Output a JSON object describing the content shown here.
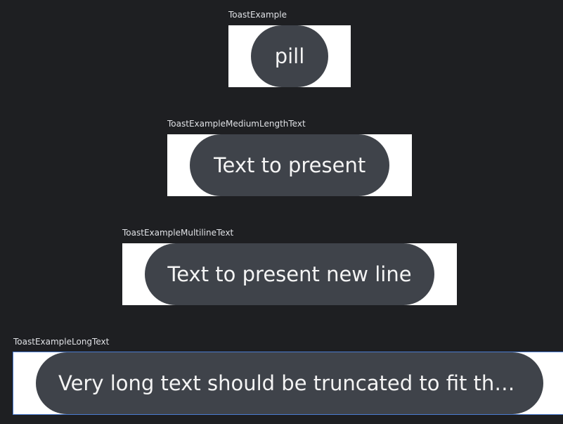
{
  "previews": [
    {
      "label": "ToastExample",
      "toast_text": "pill"
    },
    {
      "label": "ToastExampleMediumLengthText",
      "toast_text": "Text to present"
    },
    {
      "label": "ToastExampleMultilineText",
      "toast_text": "Text to present new line"
    },
    {
      "label": "ToastExampleLongText",
      "toast_text": "Very long text should be truncated to fit the…"
    }
  ]
}
